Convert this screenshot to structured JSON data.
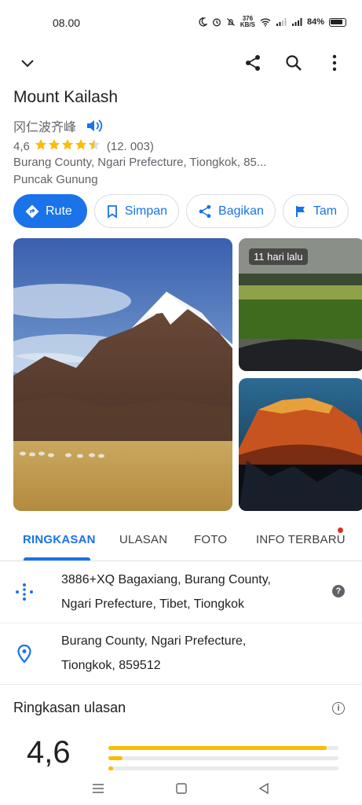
{
  "status_bar": {
    "time": "08.00",
    "speed_value": "376",
    "speed_unit": "KB/S",
    "battery": "84%"
  },
  "place": {
    "title": "Mount Kailash",
    "native_name": "冈仁波齐峰",
    "rating": "4,6",
    "review_count": "(12. 003)",
    "stars_filled": 4.5,
    "address": "Burang County,  Ngari Prefecture,  Tiongkok,  85...",
    "category": "Puncak Gunung"
  },
  "actions": [
    {
      "label": "Rute",
      "icon": "directions-icon"
    },
    {
      "label": "Simpan",
      "icon": "bookmark-icon"
    },
    {
      "label": "Bagikan",
      "icon": "share-icon"
    },
    {
      "label": "Tam",
      "icon": "flag-icon"
    }
  ],
  "photos": {
    "side_badge": "11 hari lalu"
  },
  "tabs": [
    {
      "label": "RINGKASAN",
      "active": true
    },
    {
      "label": "ULASAN",
      "active": false
    },
    {
      "label": "FOTO",
      "active": false
    },
    {
      "label": "INFO TERBARU",
      "active": false
    }
  ],
  "info_rows": [
    {
      "line1": "3886+XQ Bagaxiang,  Burang County,",
      "line2": "Ngari Prefecture,  Tibet,  Tiongkok",
      "icon": "plus-code-icon"
    },
    {
      "line1": "Burang County,  Ngari Prefecture,",
      "line2": "Tiongkok,  859512",
      "icon": "location-pin-icon"
    }
  ],
  "review_summary": {
    "title": "Ringkasan ulasan",
    "score": "4,6",
    "bars": [
      0.95,
      0.06,
      0.02
    ]
  },
  "colors": {
    "accent": "#1a73e8",
    "star": "#fbbc04",
    "notification": "#d93025"
  }
}
